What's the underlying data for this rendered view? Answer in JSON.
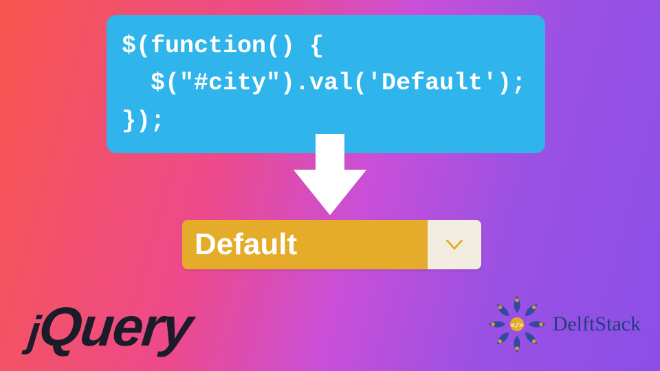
{
  "code": {
    "line1": "$(function() {",
    "line2": "  $(\"#city\").val('Default');",
    "line3": "});"
  },
  "select": {
    "value": "Default"
  },
  "logos": {
    "jquery": "jQuery",
    "delftstack": "DelftStack"
  }
}
